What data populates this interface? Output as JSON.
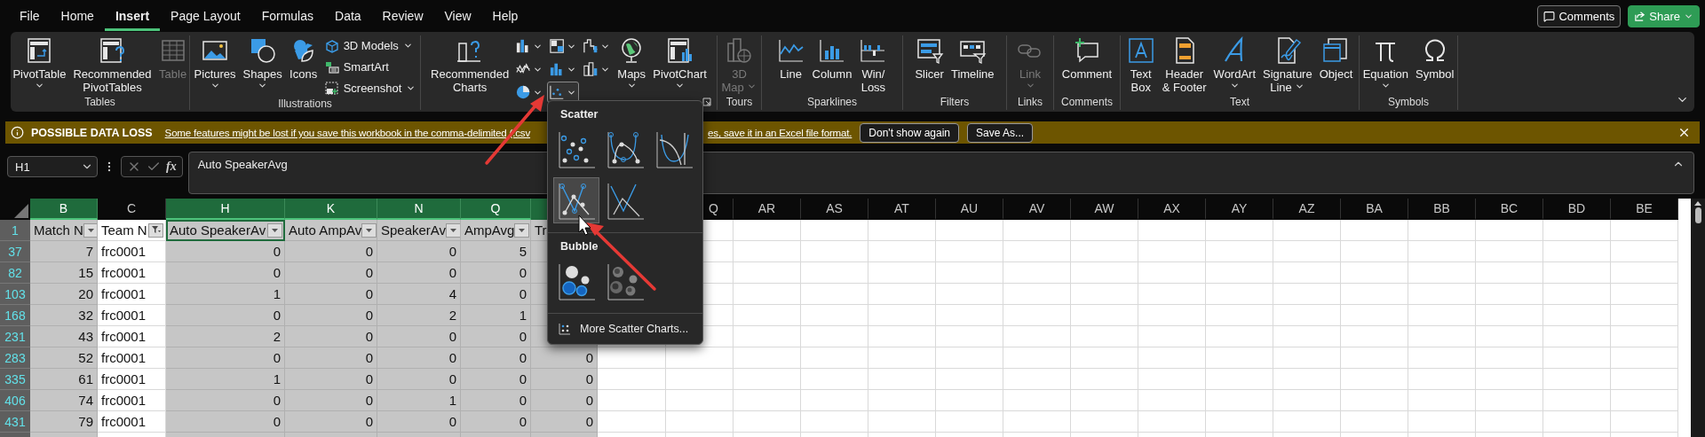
{
  "menu_tabs": [
    {
      "label": "File",
      "selected": false
    },
    {
      "label": "Home",
      "selected": false
    },
    {
      "label": "Insert",
      "selected": true
    },
    {
      "label": "Page Layout",
      "selected": false
    },
    {
      "label": "Formulas",
      "selected": false
    },
    {
      "label": "Data",
      "selected": false
    },
    {
      "label": "Review",
      "selected": false
    },
    {
      "label": "View",
      "selected": false
    },
    {
      "label": "Help",
      "selected": false
    }
  ],
  "header_buttons": [
    {
      "kind": "comments",
      "label": "Comments"
    },
    {
      "kind": "share",
      "label": "Share"
    }
  ],
  "ribbon": {
    "groups": [
      {
        "label": "Tables",
        "buttons": [
          {
            "kind": "pivot",
            "label": "PivotTable",
            "caret": true,
            "disabled": false
          },
          {
            "kind": "recpivot",
            "label": "Recommended\nPivotTables",
            "caret": false,
            "disabled": false
          },
          {
            "kind": "table",
            "label": "Table",
            "caret": false,
            "disabled": true
          }
        ]
      },
      {
        "label": "Illustrations",
        "buttons": [
          {
            "kind": "pictures",
            "label": "Pictures",
            "caret": true,
            "disabled": false
          },
          {
            "kind": "shapes",
            "label": "Shapes",
            "caret": true,
            "disabled": false
          },
          {
            "kind": "icons",
            "label": "Icons",
            "caret": false,
            "disabled": false
          },
          {
            "kind": "models",
            "label": "3D Models",
            "caret": true,
            "disabled": false
          },
          {
            "kind": "smartart",
            "label": "SmartArt",
            "caret": false,
            "disabled": false
          },
          {
            "kind": "screenshot",
            "label": "Screenshot",
            "caret": true,
            "disabled": false
          }
        ]
      },
      {
        "launcher": true,
        "buttons": [
          {
            "kind": "recchart",
            "label": "Recommended\nCharts",
            "caret": false,
            "disabled": false
          },
          {
            "kind": "bar",
            "expanded": false
          },
          {
            "kind": "hierarchy",
            "expanded": false
          },
          {
            "kind": "waterfall",
            "expanded": false
          },
          {
            "kind": "line",
            "expanded": false
          },
          {
            "kind": "statistic",
            "expanded": false
          },
          {
            "kind": "combo",
            "expanded": false
          },
          {
            "kind": "pie",
            "expanded": false
          },
          {
            "kind": "scatter",
            "expanded": true
          },
          {
            "kind": "maps",
            "label": "Maps",
            "caret": true,
            "disabled": false
          },
          {
            "kind": "pivotchart",
            "label": "PivotChart",
            "caret": true,
            "disabled": false
          }
        ]
      },
      {
        "label": "Tours",
        "buttons": [
          {
            "kind": "map3d",
            "label": "3D\nMap",
            "caret": true,
            "disabled": true
          }
        ]
      },
      {
        "label": "Sparklines",
        "buttons": [
          {
            "kind": "sparkline",
            "label": "Line",
            "caret": false,
            "disabled": false
          },
          {
            "kind": "sparkcolumn",
            "label": "Column",
            "caret": false,
            "disabled": false
          },
          {
            "kind": "winloss",
            "label": "Win/\nLoss",
            "caret": false,
            "disabled": false
          }
        ]
      },
      {
        "label": "Filters",
        "buttons": [
          {
            "kind": "slicer",
            "label": "Slicer",
            "caret": false,
            "disabled": false
          },
          {
            "kind": "timeline",
            "label": "Timeline",
            "caret": false,
            "disabled": false
          }
        ]
      },
      {
        "label": "Links",
        "buttons": [
          {
            "kind": "link",
            "label": "Link",
            "caret": true,
            "disabled": true
          }
        ]
      },
      {
        "label": "Comments",
        "buttons": [
          {
            "kind": "comment",
            "label": "Comment",
            "caret": false,
            "disabled": false
          }
        ]
      },
      {
        "label": "Text",
        "buttons": [
          {
            "kind": "textbox",
            "label": "Text\nBox",
            "caret": false,
            "disabled": false
          },
          {
            "kind": "headerfooter",
            "label": "Header\n& Footer",
            "caret": false,
            "disabled": false
          },
          {
            "kind": "wordart",
            "label": "WordArt",
            "caret": true,
            "disabled": false
          },
          {
            "kind": "signature",
            "label": "Signature\nLine",
            "caret": true,
            "disabled": false
          },
          {
            "kind": "object",
            "label": "Object",
            "caret": false,
            "disabled": false
          }
        ]
      },
      {
        "label": "Symbols",
        "buttons": [
          {
            "kind": "equation",
            "label": "Equation",
            "caret": true,
            "disabled": false
          },
          {
            "kind": "symbol",
            "label": "Symbol",
            "caret": false,
            "disabled": false
          }
        ]
      }
    ]
  },
  "warning_bar": {
    "title": "POSSIBLE DATA LOSS",
    "message_start": "Some features might be lost if you save this workbook in the comma-delimited (.csv",
    "message_end": "es, save it in an Excel file format.",
    "buttons": [
      "Don't show again",
      "Save As..."
    ]
  },
  "formula_bar": {
    "name_box": "H1",
    "fx": "fx",
    "formula": "Auto SpeakerAvg"
  },
  "dropdown": {
    "sections": [
      {
        "title": "Scatter",
        "options": [
          {
            "kind": "dots",
            "selected": false
          },
          {
            "kind": "smoothdots",
            "selected": false
          },
          {
            "kind": "smooth",
            "selected": false
          },
          {
            "kind": "linedots",
            "selected": true
          },
          {
            "kind": "line",
            "selected": false
          }
        ]
      },
      {
        "title": "Bubble",
        "options": [
          {
            "kind": "bubble",
            "selected": false
          },
          {
            "kind": "bubble3d",
            "selected": false
          }
        ]
      }
    ],
    "more": "More Scatter Charts..."
  },
  "sheet": {
    "columns": [
      {
        "letter": "B",
        "selected": true
      },
      {
        "letter": "C",
        "selected": false
      },
      {
        "letter": "H",
        "selected": true
      },
      {
        "letter": "K",
        "selected": true
      },
      {
        "letter": "N",
        "selected": true
      },
      {
        "letter": "Q",
        "selected": true
      },
      {
        "selected": true
      },
      {},
      {
        "letter": "Q",
        "selected": false
      },
      {
        "letter": "AR",
        "selected": false
      },
      {
        "letter": "AS",
        "selected": false
      },
      {
        "letter": "AT",
        "selected": false
      },
      {
        "letter": "AU",
        "selected": false
      },
      {
        "letter": "AV",
        "selected": false
      },
      {
        "letter": "AW",
        "selected": false
      },
      {
        "letter": "AX",
        "selected": false
      },
      {
        "letter": "AY",
        "selected": false
      },
      {
        "letter": "AZ",
        "selected": false
      },
      {
        "letter": "BA",
        "selected": false
      },
      {
        "letter": "BB",
        "selected": false
      },
      {
        "letter": "BC",
        "selected": false
      },
      {
        "letter": "BD",
        "selected": false
      },
      {
        "letter": "BE",
        "selected": false
      }
    ],
    "header_row": {
      "number": "1",
      "cells": [
        {
          "text": "Match N",
          "filter_button": true,
          "filtered": false,
          "active": false
        },
        {
          "text": "Team N",
          "filter_button": true,
          "filtered": true,
          "active": false
        },
        {
          "text": "Auto SpeakerAv",
          "filter_button": true,
          "filtered": false,
          "active": true
        },
        {
          "text": "Auto AmpAv",
          "filter_button": true,
          "filtered": false,
          "active": false
        },
        {
          "text": "SpeakerAv",
          "filter_button": true,
          "filtered": false,
          "active": false
        },
        {
          "text": "AmpAvg",
          "filter_button": true,
          "filtered": false,
          "active": false
        },
        {
          "text": "Tr",
          "active": false
        }
      ]
    },
    "rows": [
      {
        "number": "37",
        "cells": [
          "7",
          "frc0001",
          "0",
          "0",
          "0",
          "5"
        ]
      },
      {
        "number": "82",
        "cells": [
          "15",
          "frc0001",
          "0",
          "0",
          "0",
          "0"
        ]
      },
      {
        "number": "103",
        "cells": [
          "20",
          "frc0001",
          "1",
          "0",
          "4",
          "0"
        ]
      },
      {
        "number": "168",
        "cells": [
          "32",
          "frc0001",
          "0",
          "0",
          "2",
          "1"
        ]
      },
      {
        "number": "231",
        "cells": [
          "43",
          "frc0001",
          "2",
          "0",
          "0",
          "0"
        ]
      },
      {
        "number": "283",
        "cells": [
          "52",
          "frc0001",
          "0",
          "0",
          "0",
          "0",
          "0"
        ]
      },
      {
        "number": "335",
        "cells": [
          "61",
          "frc0001",
          "1",
          "0",
          "0",
          "0",
          "0"
        ]
      },
      {
        "number": "406",
        "cells": [
          "74",
          "frc0001",
          "0",
          "0",
          "1",
          "0",
          "0"
        ]
      },
      {
        "number": "431",
        "cells": [
          "79",
          "frc0001",
          "0",
          "0",
          "0",
          "0",
          "0"
        ]
      }
    ]
  }
}
